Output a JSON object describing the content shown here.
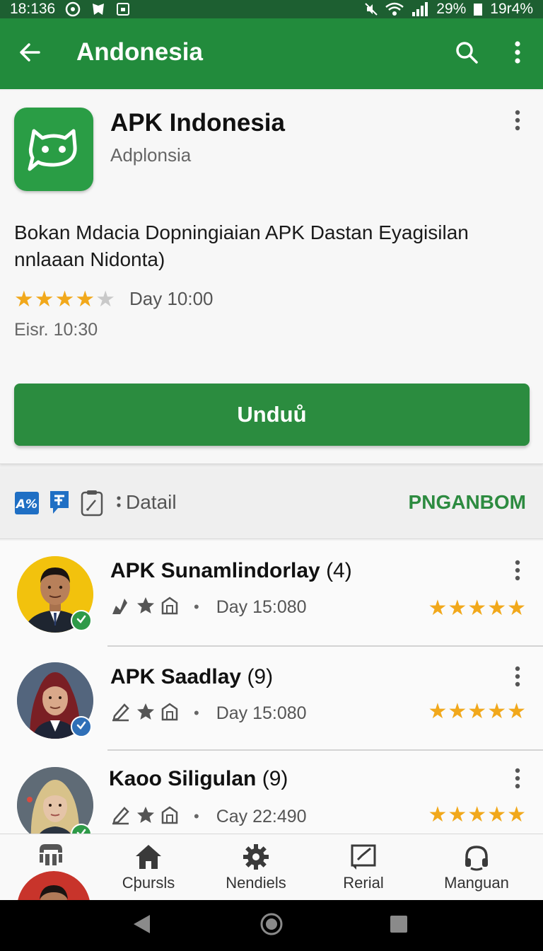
{
  "status_bar": {
    "time": "18:136",
    "battery": "29%",
    "right_time": "19r4%"
  },
  "app_bar": {
    "title": "Andonesia",
    "back_icon": "arrow-left-icon",
    "search_icon": "search-icon",
    "menu_icon": "more-vert-icon"
  },
  "app": {
    "name": "APK Indonesia",
    "developer": "Adplonsia",
    "description": "Bokan Mdacia Dopningiaian APK Dastan Eyagisilan nnlaaan Nidonta)",
    "rating": 4,
    "rating_max": 5,
    "rating_time": "Day 10:00",
    "eisr": "Eisr. 10:30",
    "download_label": "Unduů",
    "icon_color": "#2a9d45"
  },
  "detail_bar": {
    "label": "Datail",
    "action": "PNGANBOM"
  },
  "list_items": [
    {
      "title": "APK Sunamlindorlay",
      "count": "(4)",
      "time": "Day 15:080",
      "rating": 5,
      "verified_color": "#2e9a48"
    },
    {
      "title": "APK Saadlay",
      "count": "(9)",
      "time": "Day 15:080",
      "rating": 5,
      "verified_color": "#2f6fb7"
    },
    {
      "title": "Kaoo Siligulan",
      "count": "(9)",
      "time": "Cay 22:490",
      "rating": 5,
      "verified_color": "#2e9a48"
    }
  ],
  "bottom_nav": [
    {
      "label": "",
      "icon": "app-logo-icon"
    },
    {
      "label": "Cþursls",
      "icon": "home-icon"
    },
    {
      "label": "Nendiels",
      "icon": "gear-icon"
    },
    {
      "label": "Rerial",
      "icon": "edit-square-icon"
    },
    {
      "label": "Manguan",
      "icon": "headset-icon"
    }
  ],
  "colors": {
    "primary": "#228b3c",
    "status_bar": "#1d5f31",
    "star": "#f1a81b",
    "accent_text": "#2d8b40"
  }
}
